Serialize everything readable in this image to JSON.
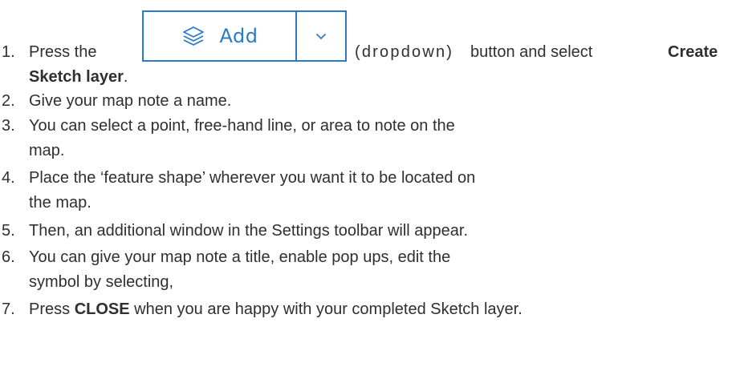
{
  "steps": [
    {
      "num": "1.",
      "pre": "Press the",
      "button_hint": "(dropdown)",
      "mid": "button and select",
      "bold": "Create",
      "bold_cont": "Sketch layer",
      "tail": "."
    },
    {
      "num": "2.",
      "text": "Give your map note a name."
    },
    {
      "num": "3.",
      "line1": "You can select a point, free-hand line, or area to note on the",
      "line2": "map."
    },
    {
      "num": "4.",
      "line1": "Place the ‘feature shape’ wherever you want it to be located on",
      "line2": "the map."
    },
    {
      "num": "5.",
      "text": "Then, an additional window in the Settings toolbar will appear."
    },
    {
      "num": "6.",
      "line1": "You can give your map note a title, enable pop ups, edit the",
      "line2": "symbol by selecting,"
    },
    {
      "num": "7.",
      "pre": "Press",
      "bold": "CLOSE",
      "post": "when you are happy with your completed Sketch layer."
    }
  ],
  "add_button": {
    "label": "Add",
    "icon": "layers-icon",
    "caret_icon": "chevron-down-icon",
    "accent": "#2a7bc6"
  }
}
